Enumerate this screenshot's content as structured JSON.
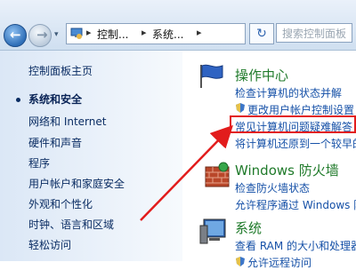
{
  "nav": {
    "back_glyph": "←",
    "forward_glyph": "→",
    "history_glyph": "▾"
  },
  "address": {
    "crumbs": [
      "控制...",
      "系统..."
    ],
    "separator": "▸"
  },
  "refresh_glyph": "↻",
  "search": {
    "placeholder": "搜索控制面板"
  },
  "sidebar": {
    "home": "控制面板主页",
    "items": [
      "系统和安全",
      "网络和 Internet",
      "硬件和声音",
      "程序",
      "用户帐户和家庭安全",
      "外观和个性化",
      "时钟、语言和区域",
      "轻松访问"
    ],
    "active_index": 0
  },
  "categories": [
    {
      "title": "操作中心",
      "links": [
        "检查计算机的状态并解",
        "更改用户帐户控制设置",
        "常见计算机问题疑难解答",
        "将计算机还原到一个较早的"
      ]
    },
    {
      "title": "Windows 防火墙",
      "links": [
        "检查防火墙状态",
        "允许程序通过 Windows 防"
      ]
    },
    {
      "title": "系统",
      "links": [
        "查看 RAM 的大小和处理器",
        "允许远程访问"
      ]
    }
  ],
  "highlight": {
    "color": "#e21c1c"
  }
}
